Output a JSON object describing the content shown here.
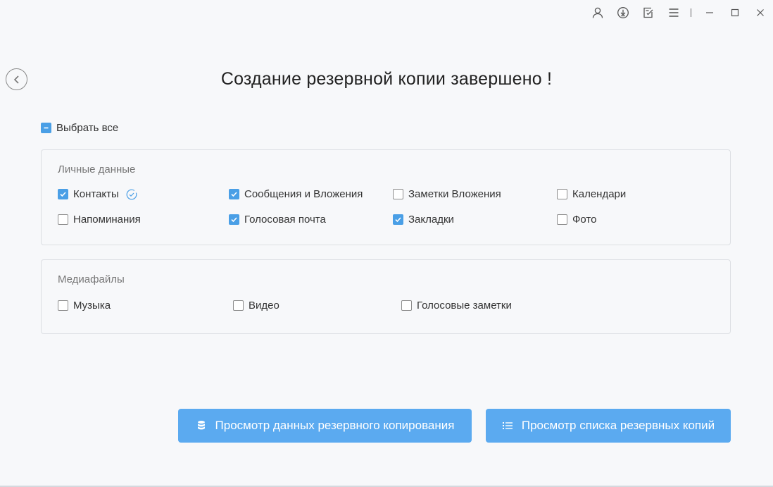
{
  "title": "Создание резервной копии завершено !",
  "select_all": {
    "label": "Выбрать все",
    "state": "partial"
  },
  "personal": {
    "title": "Личные данные",
    "items": [
      {
        "label": "Контакты",
        "checked": true
      },
      {
        "label": "Сообщения и Вложения",
        "checked": true
      },
      {
        "label": "Заметки Вложения",
        "checked": false
      },
      {
        "label": "Календари",
        "checked": false
      },
      {
        "label": "Напоминания",
        "checked": false
      },
      {
        "label": "Голосовая почта",
        "checked": true
      },
      {
        "label": "Закладки",
        "checked": true
      },
      {
        "label": "Фото",
        "checked": false
      }
    ]
  },
  "media": {
    "title": "Медиафайлы",
    "items": [
      {
        "label": "Музыка",
        "checked": false
      },
      {
        "label": "Видео",
        "checked": false
      },
      {
        "label": "Голосовые заметки",
        "checked": false
      }
    ]
  },
  "buttons": {
    "view_data": "Просмотр данных резервного копирования",
    "view_list": "Просмотр списка резервных копий"
  },
  "colors": {
    "accent": "#4a9fe6",
    "button": "#5baaf0"
  },
  "icons": {
    "titlebar": [
      "user-icon",
      "download-icon",
      "feedback-icon",
      "menu-icon",
      "minimize-icon",
      "maximize-icon",
      "close-icon"
    ],
    "back": "chevron-left-icon",
    "verified": "check-circle-icon",
    "view_data": "database-icon",
    "view_list": "list-icon"
  }
}
